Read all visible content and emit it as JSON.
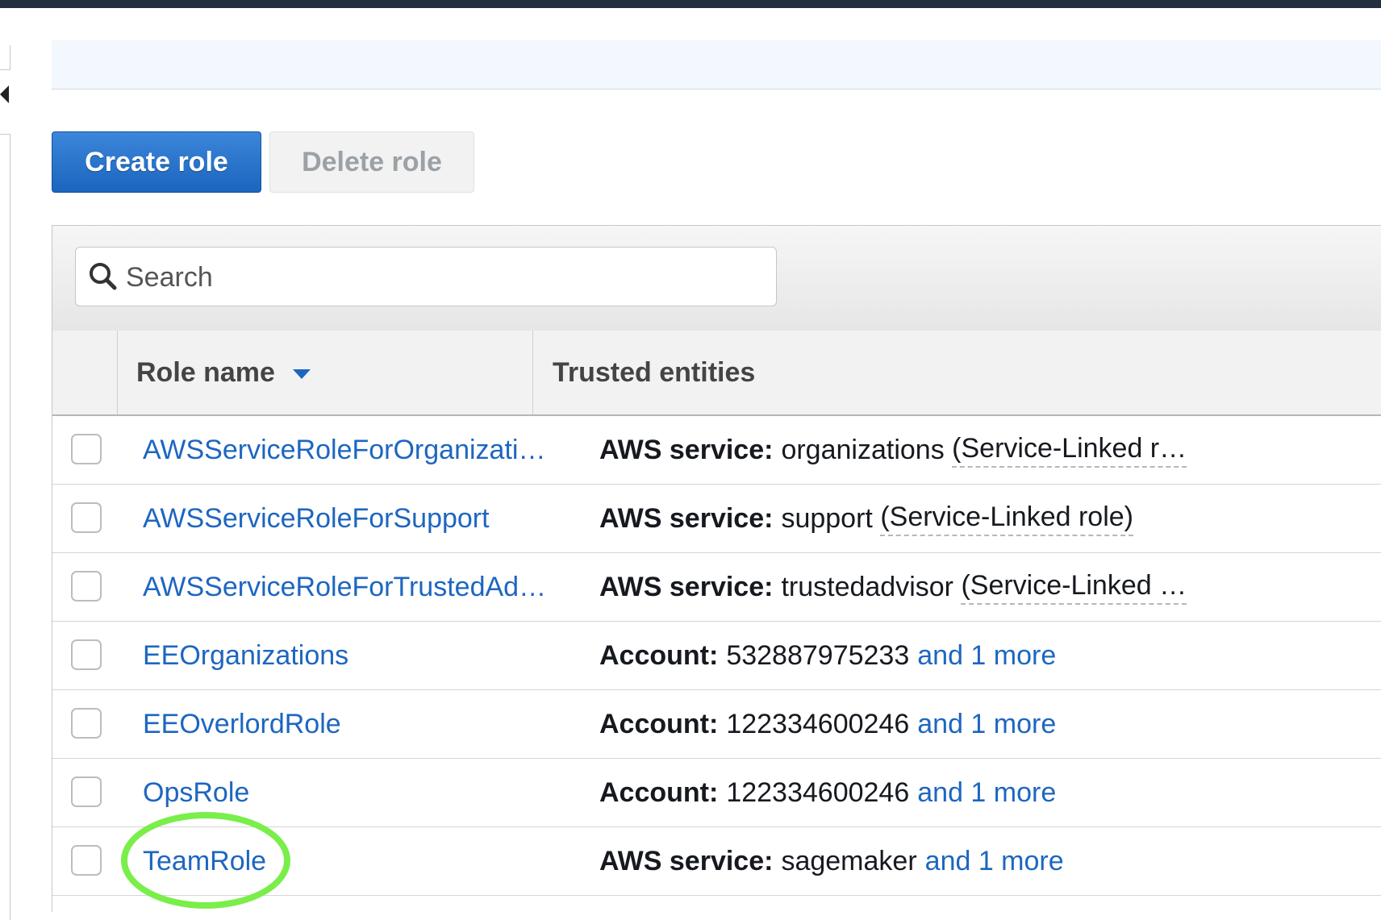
{
  "actions": {
    "create_role": "Create role",
    "delete_role": "Delete role"
  },
  "search": {
    "placeholder": "Search"
  },
  "table": {
    "columns": {
      "role_name": "Role name",
      "trusted_entities": "Trusted entities"
    },
    "rows": [
      {
        "role": "AWSServiceRoleForOrganizati…",
        "kind": "AWS service:",
        "value": "organizations",
        "detail": "(Service-Linked r…",
        "more": ""
      },
      {
        "role": "AWSServiceRoleForSupport",
        "kind": "AWS service:",
        "value": "support",
        "detail": "(Service-Linked role)",
        "more": ""
      },
      {
        "role": "AWSServiceRoleForTrustedAd…",
        "kind": "AWS service:",
        "value": "trustedadvisor",
        "detail": "(Service-Linked …",
        "more": ""
      },
      {
        "role": "EEOrganizations",
        "kind": "Account:",
        "value": "532887975233",
        "detail": "",
        "more": "and 1 more"
      },
      {
        "role": "EEOverlordRole",
        "kind": "Account:",
        "value": "122334600246",
        "detail": "",
        "more": "and 1 more"
      },
      {
        "role": "OpsRole",
        "kind": "Account:",
        "value": "122334600246",
        "detail": "",
        "more": "and 1 more"
      },
      {
        "role": "TeamRole",
        "kind": "AWS service:",
        "value": "sagemaker",
        "detail": "",
        "more": "and 1 more"
      }
    ]
  },
  "icons": {
    "search": "search-icon",
    "sort": "caret-down-icon",
    "collapse": "caret-left-icon"
  },
  "colors": {
    "primary": "#1b65c0",
    "link": "#1d66c0",
    "highlight": "#7aee4a",
    "topbar": "#232f3e"
  }
}
